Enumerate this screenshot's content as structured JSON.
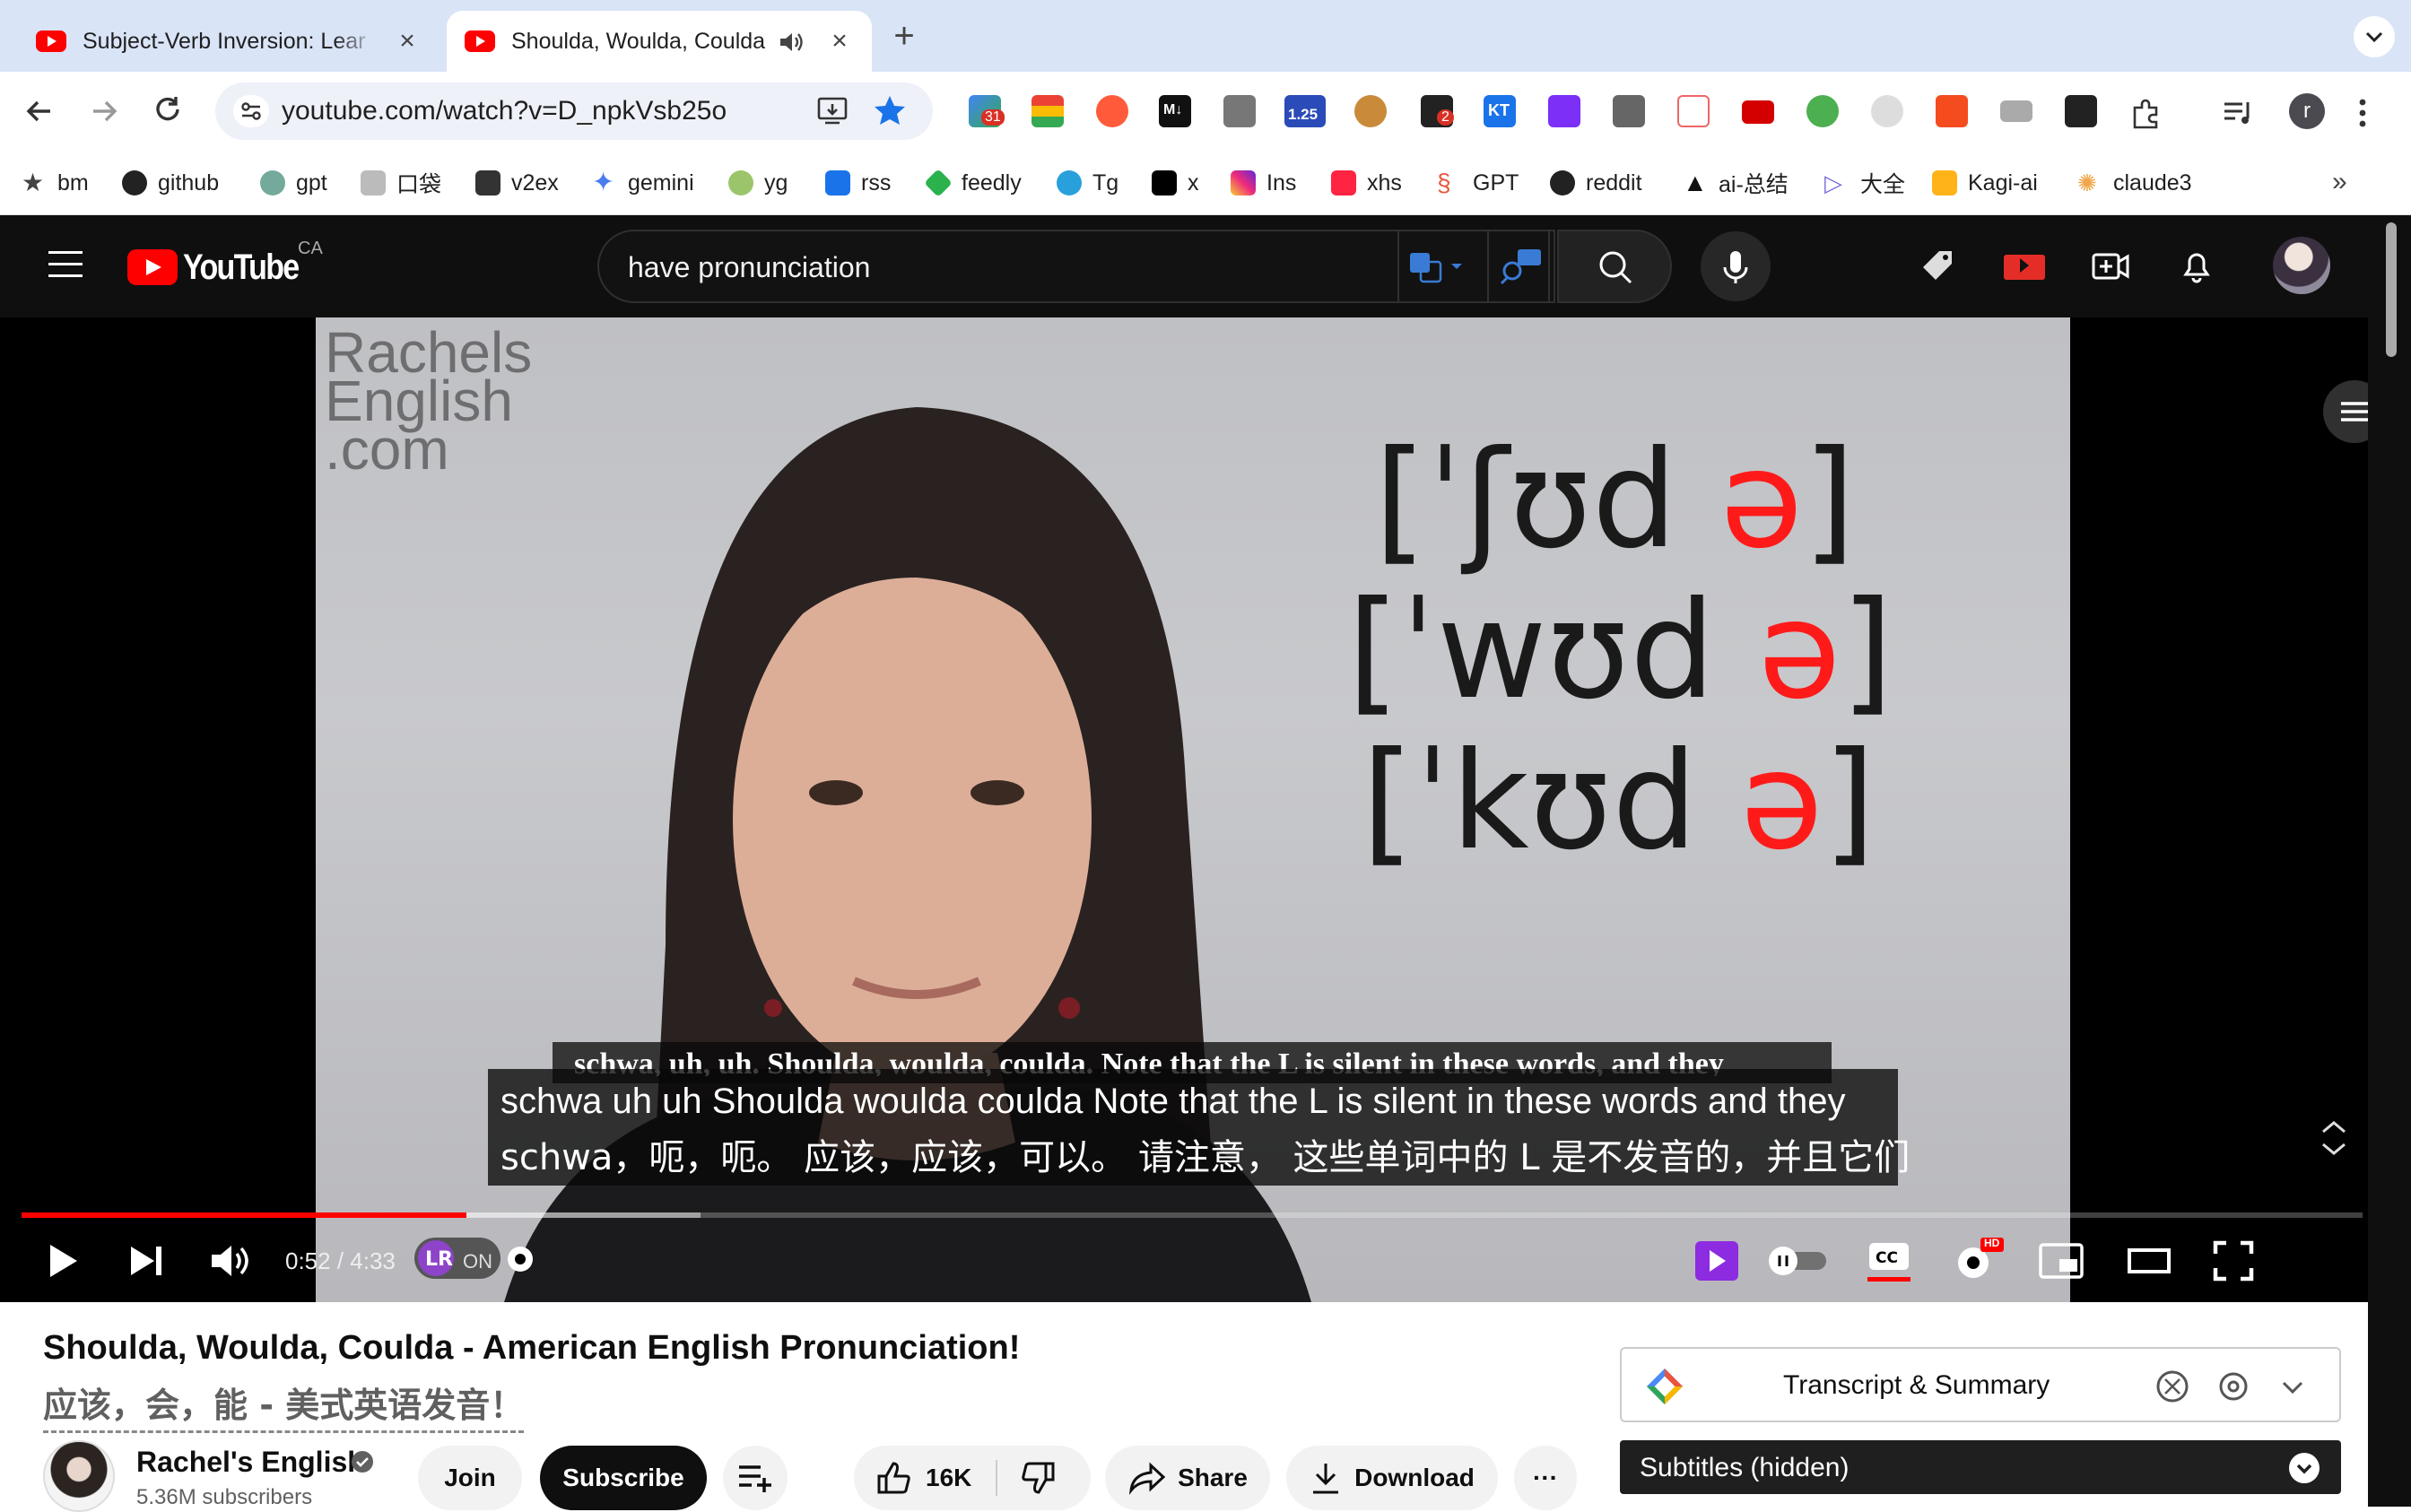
{
  "browser": {
    "tabs": [
      {
        "title": "Subject-Verb Inversion: Lear",
        "active": false
      },
      {
        "title": "Shoulda, Woulda, Coulda",
        "active": true
      }
    ],
    "url": "youtube.com/watch?v=D_npkVsb25o",
    "extension_badges": {
      "calendar": "31",
      "speed": "1.25",
      "notif": "2"
    },
    "profile_initial": "r",
    "bookmarks": [
      "bm",
      "github",
      "gpt",
      "口袋",
      "v2ex",
      "gemini",
      "yg",
      "rss",
      "feedly",
      "Tg",
      "x",
      "Ins",
      "xhs",
      "GPT",
      "reddit",
      "ai-总结",
      "大全",
      "Kagi-ai",
      "claude3"
    ]
  },
  "youtube": {
    "logo_text": "YouTube",
    "country_code": "CA",
    "search_value": "have pronunciation",
    "video": {
      "watermark": [
        "Rachels",
        "English",
        ".com"
      ],
      "ipa_lines": [
        {
          "word": "[ˈʃʊd ",
          "schwa": "ə",
          "close": "]"
        },
        {
          "word": "[ˈwʊd ",
          "schwa": "ə",
          "close": "]"
        },
        {
          "word": "[ˈkʊd ",
          "schwa": "ə",
          "close": "]"
        }
      ],
      "caption_original": "schwa, uh, uh. Shoulda, woulda, coulda. Note that the L is silent in these words, and they",
      "caption_en": "schwa uh uh Shoulda woulda coulda Note that the L is silent in these words and they",
      "caption_zh": "schwa，呃，呃。 应该，应该，可以。 请注意， 这些单词中的 L 是不发音的，并且它们",
      "progress_played": 0.19,
      "progress_buffered": 0.29,
      "time_current": "0:52",
      "time_sep": " / ",
      "time_total": "4:33",
      "lr_on": "ON",
      "hd_badge": "HD"
    },
    "title": "Shoulda, Woulda, Coulda - American English Pronunciation!",
    "title_zh": "应该，会，能 - 美式英语发音！",
    "channel": {
      "name": "Rachel's English",
      "subscribers": "5.36M subscribers"
    },
    "actions": {
      "join": "Join",
      "subscribe": "Subscribe",
      "likes": "16K",
      "share": "Share",
      "download": "Download",
      "more": "···"
    },
    "extension_panel": {
      "title": "Transcript & Summary"
    },
    "subtitles_bar": {
      "label": "Subtitles (hidden)"
    }
  }
}
